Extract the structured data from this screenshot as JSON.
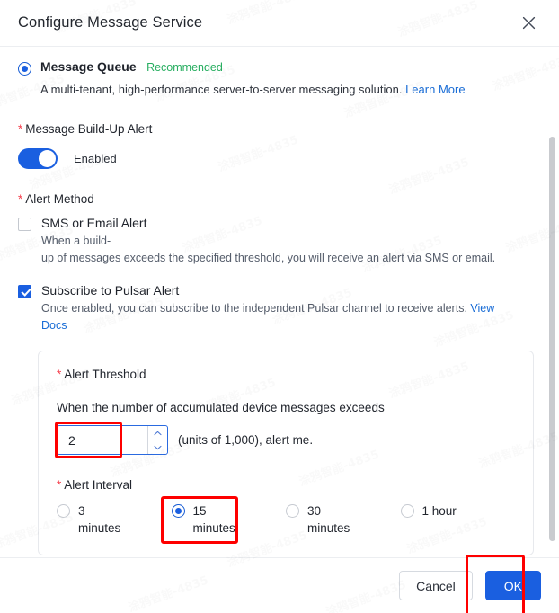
{
  "header": {
    "title": "Configure Message Service",
    "close_icon": "close-icon"
  },
  "service_option": {
    "title": "Message Queue",
    "badge": "Recommended",
    "description": "A multi-tenant, high-performance server-to-server messaging solution. ",
    "link_text": "Learn More",
    "selected": true
  },
  "build_up_alert": {
    "label": "Message Build-Up Alert",
    "required_mark": "*",
    "toggle_state": "Enabled",
    "enabled": true
  },
  "alert_method": {
    "label": "Alert Method",
    "required_mark": "*",
    "sms": {
      "title": "SMS or Email Alert",
      "desc_line1": "When a build-",
      "desc_line2": "up of messages exceeds the specified threshold, you will receive an alert via SMS or email.",
      "checked": false
    },
    "pulsar": {
      "title": "Subscribe to Pulsar Alert",
      "description": "Once enabled, you can subscribe to the independent Pulsar channel to receive alerts. ",
      "link_text": "View Docs",
      "checked": true
    }
  },
  "threshold_panel": {
    "threshold_label": "Alert Threshold",
    "required_mark": "*",
    "prompt": "When the number of accumulated device messages exceeds",
    "value": "2",
    "units_text": "(units of 1,000), alert me.",
    "spin_up_icon": "chevron-up-icon",
    "spin_down_icon": "chevron-down-icon",
    "interval_label": "Alert Interval",
    "interval_options": [
      {
        "label": "3 minutes",
        "selected": false
      },
      {
        "label": "15 minutes",
        "selected": true
      },
      {
        "label": "30 minutes",
        "selected": false
      },
      {
        "label": "1 hour",
        "selected": false
      }
    ]
  },
  "footer": {
    "cancel_label": "Cancel",
    "ok_label": "OK"
  },
  "watermark": {
    "text": "涂鸦智能-4835"
  },
  "colors": {
    "accent": "#1a5fe0",
    "link": "#1a6dd6",
    "recommended": "#27ae60",
    "required": "#f5414f",
    "annotation": "#fe0000"
  }
}
